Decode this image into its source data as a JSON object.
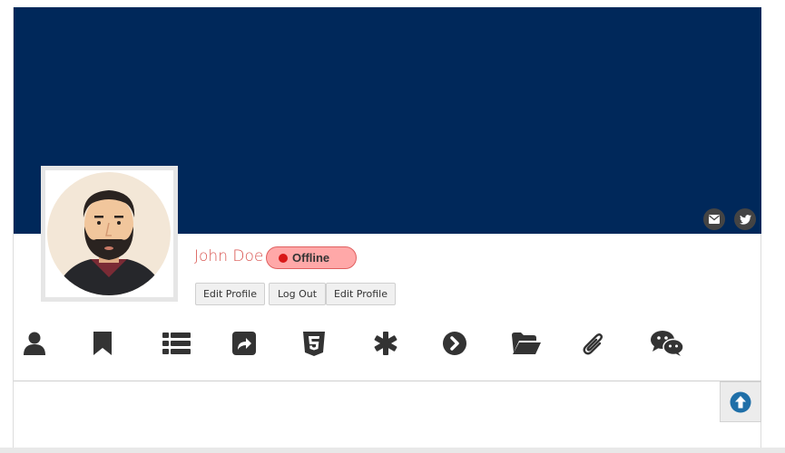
{
  "profile": {
    "name": "John Doe",
    "status": "Offline",
    "status_color": "#d81818"
  },
  "cover": {
    "background": "#00285a"
  },
  "social": [
    {
      "icon": "envelope-icon"
    },
    {
      "icon": "twitter-icon"
    }
  ],
  "actions": {
    "edit_profile_label": "Edit Profile",
    "logout_label": "Log Out",
    "edit_profile_label_2": "Edit Profile"
  },
  "tabs": [
    {
      "icon": "user-icon"
    },
    {
      "icon": "bookmark-icon"
    },
    {
      "icon": "list-icon"
    },
    {
      "icon": "share-icon"
    },
    {
      "icon": "html5-icon"
    },
    {
      "icon": "asterisk-icon"
    },
    {
      "icon": "chevron-circle-right-icon"
    },
    {
      "icon": "folder-open-icon"
    },
    {
      "icon": "paperclip-icon"
    },
    {
      "icon": "wechat-icon"
    }
  ],
  "scroll_top": {
    "icon": "arrow-circle-up-icon",
    "color": "#1f6fa8"
  }
}
